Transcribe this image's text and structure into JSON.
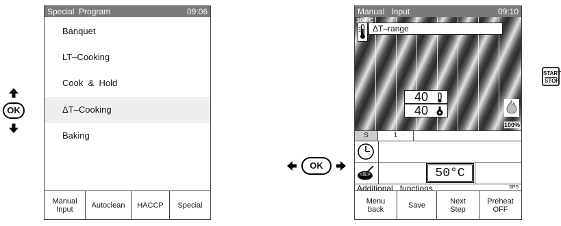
{
  "left_panel": {
    "title": "Special  Program",
    "clock": "09:06",
    "items": [
      {
        "label": "Banquet"
      },
      {
        "label": "LT–Cooking"
      },
      {
        "label": "Cook  &  Hold"
      },
      {
        "label": "ΔT–Cooking",
        "selected": true
      },
      {
        "label": "Baking"
      }
    ],
    "softkeys": [
      "Manual\nInput",
      "Autoclean",
      "HACCP",
      "Special"
    ]
  },
  "left_nav": {
    "ok_label": "OK"
  },
  "right_panel": {
    "title": "Manual   Input",
    "clock": "09:10",
    "graph": {
      "temp_label": "300°C",
      "program_label": "ΔT–range",
      "core_temp": "40",
      "delta_temp": "40",
      "power": "100%"
    },
    "step_tab": "S",
    "step_number": "1",
    "set_temp": "50°C",
    "additional_functions": "Additional   functions",
    "sps": "SPS",
    "softkeys": [
      "Menu\nback",
      "Save",
      "Next\nStep",
      "Preheat\nOFF"
    ]
  },
  "right_nav": {
    "ok_label": "OK"
  },
  "start_stop": {
    "line1": "START",
    "line2": "STOP"
  }
}
